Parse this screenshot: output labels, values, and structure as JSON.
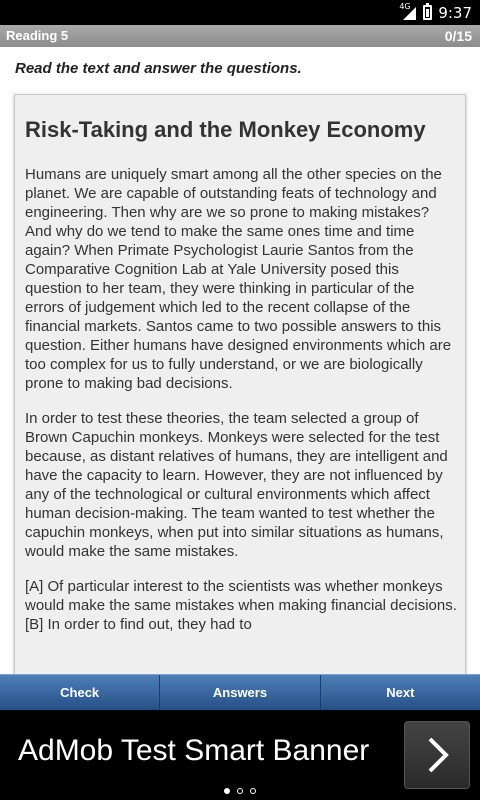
{
  "statusbar": {
    "network": "4G",
    "time": "9:37"
  },
  "header": {
    "title": "Reading 5",
    "counter": "0/15"
  },
  "instructions": "Read the text and answer the questions.",
  "reading": {
    "title": "Risk-Taking and the Monkey Economy",
    "paragraphs": [
      "Humans are uniquely smart among all the other species on the planet.  We are capable of outstanding feats of technology and engineering.  Then why are we so prone to making mistakes?  And why do we tend to make the same ones time and time again?  When Primate Psychologist Laurie Santos from the Comparative Cognition Lab at Yale University posed this question to her team, they were thinking in particular of the errors of judgement which led to the recent collapse of the financial markets.   Santos came to two possible answers to this question.  Either humans have designed environments which are too complex for us to fully understand, or we are biologically prone to making bad decisions.",
      "In order to test these theories, the team selected a group of Brown Capuchin monkeys.  Monkeys were selected for the test because, as distant relatives of humans, they are intelligent and have the capacity to learn.  However, they are not influenced by any of the technological or cultural environments which affect human decision-making.  The team wanted to test whether the capuchin monkeys, when put into similar situations as humans, would make the same mistakes.",
      "[A] Of particular interest to the scientists was whether monkeys would make the same mistakes when making financial decisions.  [B] In order to find out, they had to"
    ]
  },
  "buttons": {
    "check": "Check",
    "answers": "Answers",
    "next": "Next"
  },
  "ad": {
    "text": "AdMob Test Smart Banner",
    "icon": "chevron-right-icon"
  }
}
